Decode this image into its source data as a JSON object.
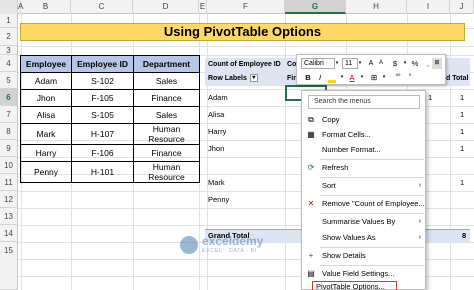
{
  "columns": [
    "A",
    "B",
    "C",
    "D",
    "E",
    "F",
    "G",
    "H",
    "I",
    "J"
  ],
  "selected_column": "G",
  "rows": [
    "1",
    "2",
    "3",
    "4",
    "5",
    "6",
    "7",
    "8",
    "9",
    "10",
    "11",
    "12",
    "13",
    "14",
    "15"
  ],
  "selected_row": "6",
  "title": "Using PivotTable Options",
  "source_table": {
    "headers": [
      "Employee",
      "Employee ID",
      "Department"
    ],
    "rows": [
      [
        "Adam",
        "S-102",
        "Sales"
      ],
      [
        "Jhon",
        "F-105",
        "Finance"
      ],
      [
        "Alisa",
        "S-105",
        "Sales"
      ],
      [
        "Mark",
        "H-107",
        "Human Resource"
      ],
      [
        "Harry",
        "F-106",
        "Finance"
      ],
      [
        "Penny",
        "H-101",
        "Human Resource"
      ]
    ]
  },
  "pivot": {
    "value_header": "Count of Employee ID",
    "column_labels": "Colu",
    "row_labels": "Row Labels",
    "finance_partial": "Finan",
    "names": [
      "Adam",
      "Alisa",
      "Harry",
      "Jhon",
      "Mark",
      "Penny"
    ],
    "grand_total_label": "Grand Total",
    "grand_total_col_header": "d Total",
    "right_values": [
      "1",
      "1",
      "1",
      "1",
      "1",
      "1"
    ],
    "grand_total_value": "8",
    "right_partial_p": "P"
  },
  "mini_toolbar": {
    "font": "Calibri",
    "size": "11",
    "percent": "%",
    "bold": "B",
    "italic": "I",
    "font_color_letter": "A",
    "comma": ","
  },
  "context_menu": {
    "search_placeholder": "Search the menus",
    "items": [
      {
        "label": "Copy",
        "icon": "copy-icon",
        "submenu": false
      },
      {
        "label": "Format Cells...",
        "icon": "format-cells-icon",
        "submenu": false
      },
      {
        "label": "Number Format...",
        "icon": "",
        "submenu": false
      },
      {
        "label": "Refresh",
        "icon": "refresh-icon",
        "submenu": false
      },
      {
        "label": "Sort",
        "icon": "",
        "submenu": true
      },
      {
        "label": "Remove \"Count of Employee...",
        "icon": "remove-icon",
        "submenu": false
      },
      {
        "label": "Summarise Values By",
        "icon": "",
        "submenu": true
      },
      {
        "label": "Show Values As",
        "icon": "",
        "submenu": true
      },
      {
        "label": "Show Details",
        "icon": "show-details-icon",
        "submenu": false
      },
      {
        "label": "Value Field Settings...",
        "icon": "value-field-settings-icon",
        "submenu": false
      },
      {
        "label": "PivotTable Options...",
        "icon": "",
        "submenu": false
      }
    ]
  },
  "watermark": {
    "name": "exceldemy",
    "sub": "EXCEL · DATA · BI"
  },
  "colors": {
    "title_fill": "#fed966",
    "table_header_fill": "#b4c7e7",
    "pivot_band": "#dde5f3",
    "selection": "#217346",
    "highlight_outline": "#e03030"
  }
}
